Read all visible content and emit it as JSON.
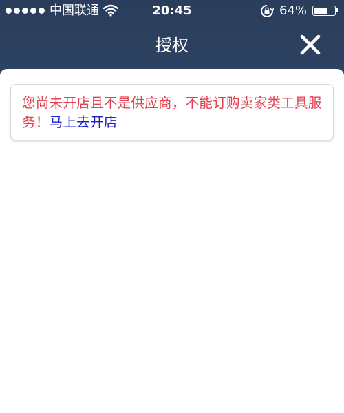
{
  "status_bar": {
    "carrier": "中国联通",
    "time": "20:45",
    "battery_percent_text": "64%",
    "battery_level": 0.64,
    "signal_bars": 5
  },
  "nav": {
    "title": "授权",
    "close_icon": "close-icon"
  },
  "notice": {
    "message": "您尚未开店且不是供应商，不能订购卖家类工具服务！",
    "link_label": "马上去开店",
    "message_color": "#e0424f",
    "link_color": "#1e1ec8"
  },
  "colors": {
    "header_bg": "#2a3d5c",
    "content_bg": "#ffffff"
  }
}
